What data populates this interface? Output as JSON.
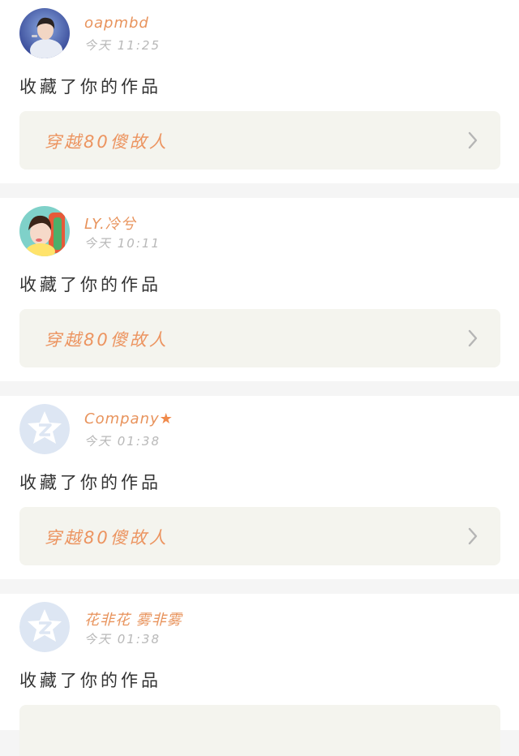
{
  "notifications": [
    {
      "username": "oapmbd",
      "time": "今天 11:25",
      "action": "收藏了你的作品",
      "work_title": "穿越80傻故人",
      "avatar": "photo-avatar-boy"
    },
    {
      "username": "LY.冷兮",
      "time": "今天 10:11",
      "action": "收藏了你的作品",
      "work_title": "穿越80傻故人",
      "avatar": "photo-avatar-girl"
    },
    {
      "username": "Company",
      "username_suffix": "★",
      "time": "今天 01:38",
      "action": "收藏了你的作品",
      "work_title": "穿越80傻故人",
      "avatar": "default-qq-avatar"
    },
    {
      "username": "花非花 雾非雾",
      "time": "今天 01:38",
      "action": "收藏了你的作品",
      "work_title": "",
      "avatar": "default-qq-avatar"
    }
  ],
  "colors": {
    "username": "#e8935c",
    "work_title": "#ec9460",
    "box_bg": "#f4f4ee",
    "separator": "#f5f5f5"
  }
}
